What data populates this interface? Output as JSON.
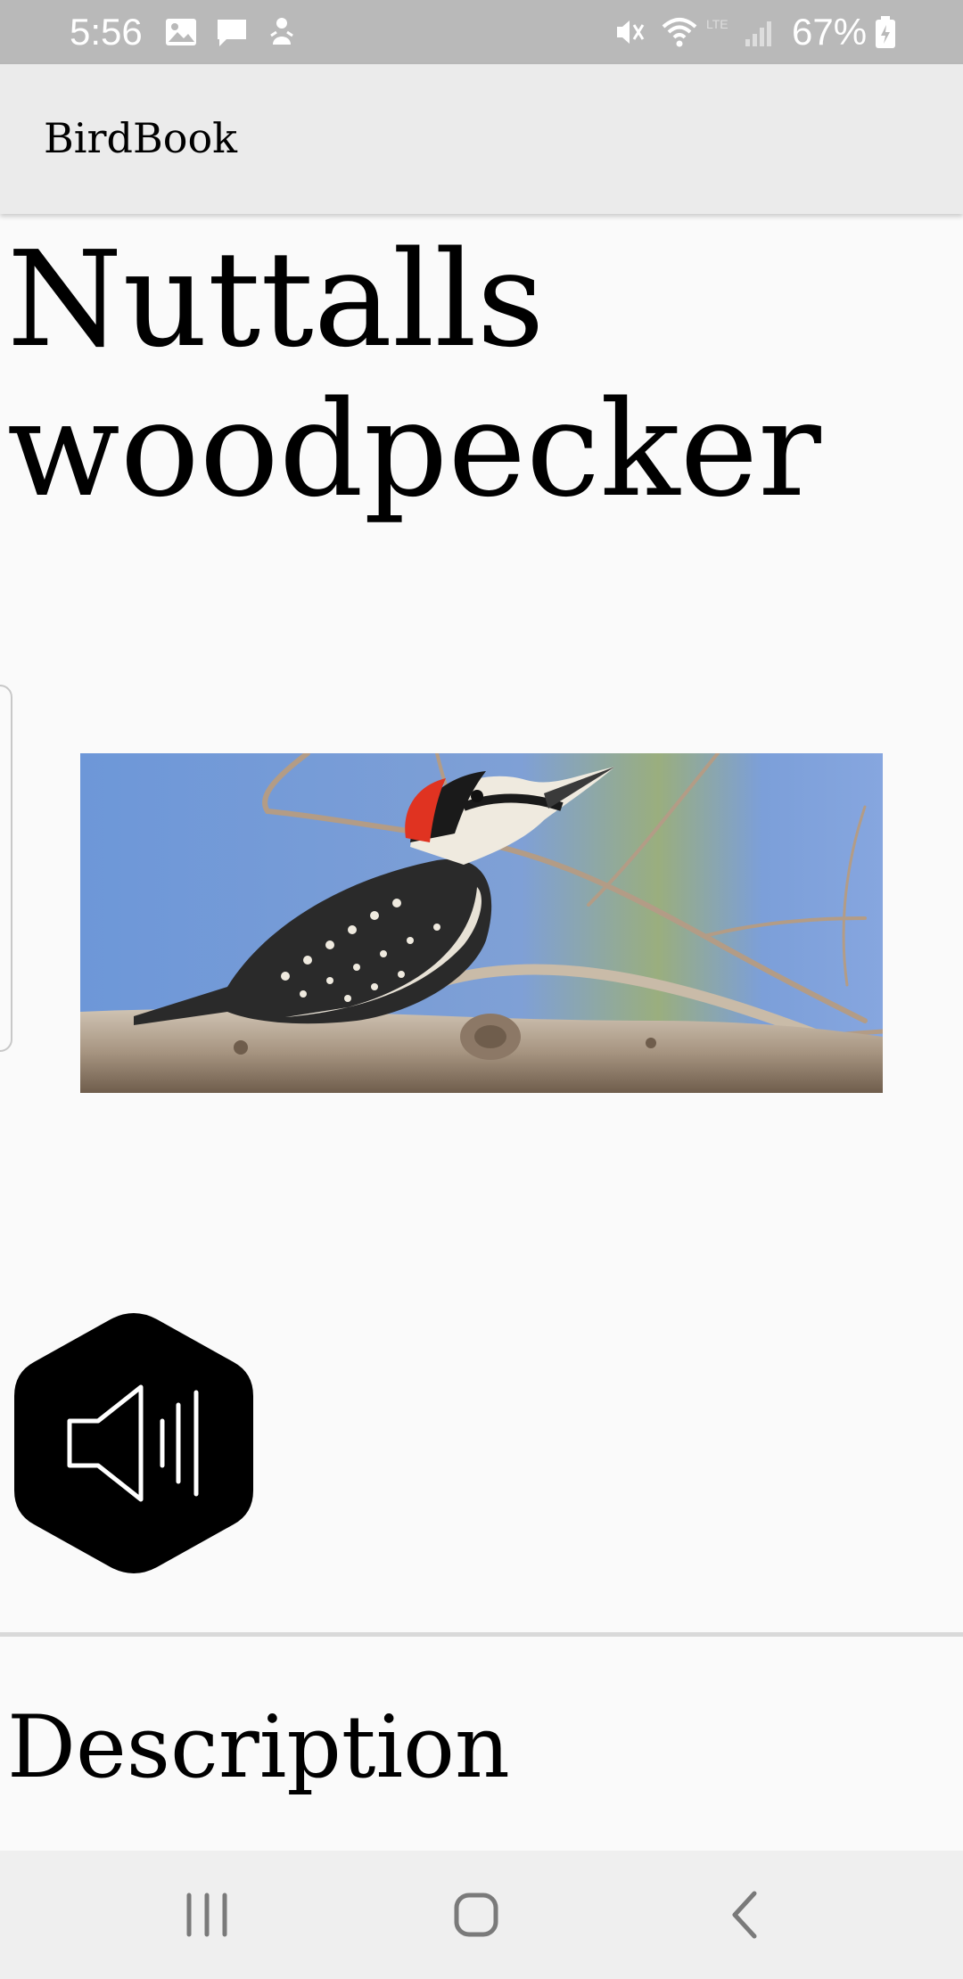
{
  "status_bar": {
    "time": "5:56",
    "battery_percent": "67%",
    "icons": [
      "gallery-icon",
      "message-icon",
      "notification-icon",
      "mute-icon",
      "wifi-icon",
      "signal-icon",
      "battery-icon"
    ]
  },
  "app_bar": {
    "title": "BirdBook"
  },
  "bird": {
    "name": "Nuttalls woodpecker",
    "sound_button_icon": "speaker-icon"
  },
  "sections": {
    "description_heading": "Description"
  },
  "nav_bar": {
    "icons": [
      "recent-apps-icon",
      "home-icon",
      "back-icon"
    ]
  },
  "colors": {
    "status_bar": "#b9b9b9",
    "app_bar": "#ebebeb",
    "background": "#fafafa",
    "sound_button": "#000000",
    "nav_bar": "#efefef"
  }
}
